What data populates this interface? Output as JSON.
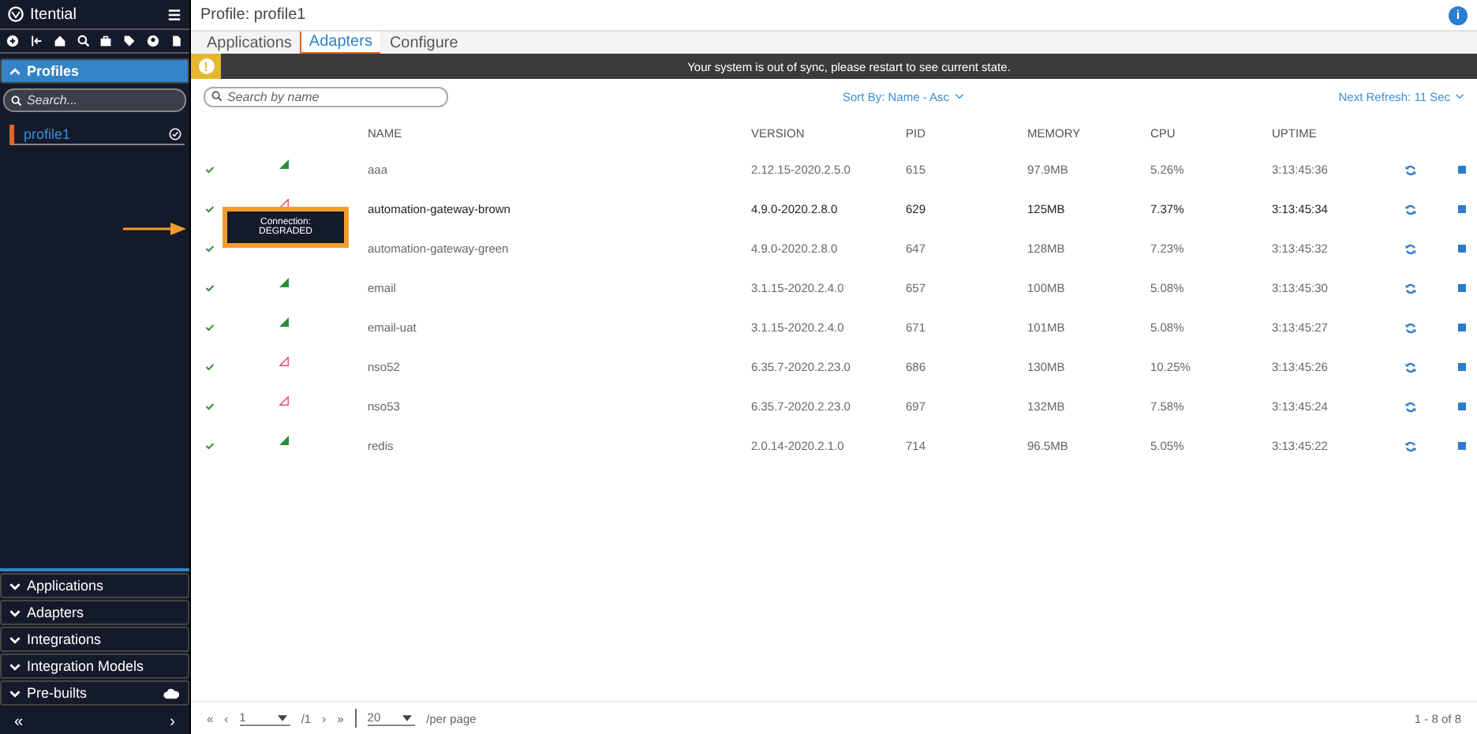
{
  "sidebar": {
    "brand": "Itential",
    "sections_expanded": [
      {
        "label": "Profiles",
        "expanded": true
      }
    ],
    "search": {
      "placeholder": "Search..."
    },
    "profiles": [
      {
        "name": "profile1",
        "selected": true,
        "active": true
      }
    ],
    "sections": [
      {
        "label": "Applications",
        "expanded": false
      },
      {
        "label": "Adapters",
        "expanded": false
      },
      {
        "label": "Integrations",
        "expanded": false
      },
      {
        "label": "Integration Models",
        "expanded": false
      },
      {
        "label": "Pre-builts",
        "expanded": false,
        "cloud": true
      }
    ],
    "footer": {
      "left": "«",
      "right": "›"
    }
  },
  "header": {
    "title": "Profile: profile1",
    "info": "i"
  },
  "tabs": [
    {
      "label": "Applications",
      "selected": false
    },
    {
      "label": "Adapters",
      "selected": true
    },
    {
      "label": "Configure",
      "selected": false
    }
  ],
  "banner": {
    "icon": "!",
    "message": "Your system is out of sync, please restart to see current state."
  },
  "toolbar": {
    "search": {
      "placeholder": "Search by name"
    },
    "sort": "Sort By: Name - Asc",
    "refresh": "Next Refresh: 11 Sec"
  },
  "table": {
    "columns": [
      "NAME",
      "VERSION",
      "PID",
      "MEMORY",
      "CPU",
      "UPTIME"
    ],
    "rows": [
      {
        "checked": true,
        "degraded": false,
        "highlighted": false,
        "name": "aaa",
        "version": "2.12.15-2020.2.5.0",
        "pid": "615",
        "memory": "97.9MB",
        "cpu": "5.26%",
        "uptime": "3:13:45:36"
      },
      {
        "checked": true,
        "degraded": true,
        "highlighted": true,
        "name": "automation-gateway-brown",
        "version": "4.9.0-2020.2.8.0",
        "pid": "629",
        "memory": "125MB",
        "cpu": "7.37%",
        "uptime": "3:13:45:34"
      },
      {
        "checked": true,
        "highlighted": false,
        "name": "automation-gateway-green",
        "version": "4.9.0-2020.2.8.0",
        "pid": "647",
        "memory": "128MB",
        "cpu": "7.23%",
        "uptime": "3:13:45:32"
      },
      {
        "checked": true,
        "degraded": false,
        "highlighted": false,
        "name": "email",
        "version": "3.1.15-2020.2.4.0",
        "pid": "657",
        "memory": "100MB",
        "cpu": "5.08%",
        "uptime": "3:13:45:30"
      },
      {
        "checked": true,
        "degraded": false,
        "highlighted": false,
        "name": "email-uat",
        "version": "3.1.15-2020.2.4.0",
        "pid": "671",
        "memory": "101MB",
        "cpu": "5.08%",
        "uptime": "3:13:45:27"
      },
      {
        "checked": true,
        "degraded": true,
        "highlighted": false,
        "name": "nso52",
        "version": "6.35.7-2020.2.23.0",
        "pid": "686",
        "memory": "130MB",
        "cpu": "10.25%",
        "uptime": "3:13:45:26"
      },
      {
        "checked": true,
        "degraded": true,
        "highlighted": false,
        "name": "nso53",
        "version": "6.35.7-2020.2.23.0",
        "pid": "697",
        "memory": "132MB",
        "cpu": "7.58%",
        "uptime": "3:13:45:24"
      },
      {
        "checked": true,
        "degraded": false,
        "highlighted": false,
        "name": "redis",
        "version": "2.0.14-2020.2.1.0",
        "pid": "714",
        "memory": "96.5MB",
        "cpu": "5.05%",
        "uptime": "3:13:45:22"
      }
    ]
  },
  "tooltip": {
    "lines": [
      "Connection:",
      "DEGRADED"
    ]
  },
  "pagination": {
    "first": "«",
    "prev": "‹",
    "page": "1",
    "total": "/1",
    "next": "›",
    "last": "»",
    "per_page": "20",
    "per_page_label": "/per page",
    "range": "1 - 8 of 8"
  }
}
